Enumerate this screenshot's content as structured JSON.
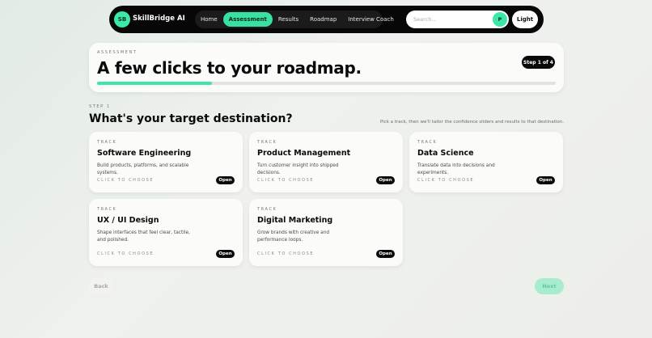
{
  "nav": {
    "brand_initials": "SB",
    "brand_name": "SkillBridge AI",
    "links": [
      "Home",
      "Assessment",
      "Results",
      "Roadmap",
      "Interview Coach"
    ],
    "active_link": "Assessment",
    "search_placeholder": "Search...",
    "avatar_initial": "P",
    "theme_label": "Light"
  },
  "hero": {
    "eyebrow": "ASSESSMENT",
    "title": "A few clicks to your roadmap.",
    "step_badge": "Step 1 of 4",
    "progress": 0.25
  },
  "section": {
    "eyebrow": "STEP 1",
    "title": "What's your target destination?",
    "hint": "Pick a track, then we'll tailor the confidence sliders and results to that destination."
  },
  "tracks": [
    {
      "eyebrow": "TRACK",
      "title": "Software Engineering",
      "desc": "Build products, platforms, and scalable systems.",
      "cta": "CLICK TO CHOOSE",
      "open": "Open"
    },
    {
      "eyebrow": "TRACK",
      "title": "Product Management",
      "desc": "Turn customer insight into shipped decisions.",
      "cta": "CLICK TO CHOOSE",
      "open": "Open"
    },
    {
      "eyebrow": "TRACK",
      "title": "Data Science",
      "desc": "Translate data into decisions and experiments.",
      "cta": "CLICK TO CHOOSE",
      "open": "Open"
    },
    {
      "eyebrow": "TRACK",
      "title": "UX / UI Design",
      "desc": "Shape interfaces that feel clear, tactile, and polished.",
      "cta": "CLICK TO CHOOSE",
      "open": "Open"
    },
    {
      "eyebrow": "TRACK",
      "title": "Digital Marketing",
      "desc": "Grow brands with creative and performance loops.",
      "cta": "CLICK TO CHOOSE",
      "open": "Open"
    }
  ],
  "footer": {
    "back_label": "Back",
    "next_label": "Next"
  },
  "colors": {
    "accent": "#3ee6a8",
    "dark": "#070707",
    "card": "#fbfbf9"
  }
}
